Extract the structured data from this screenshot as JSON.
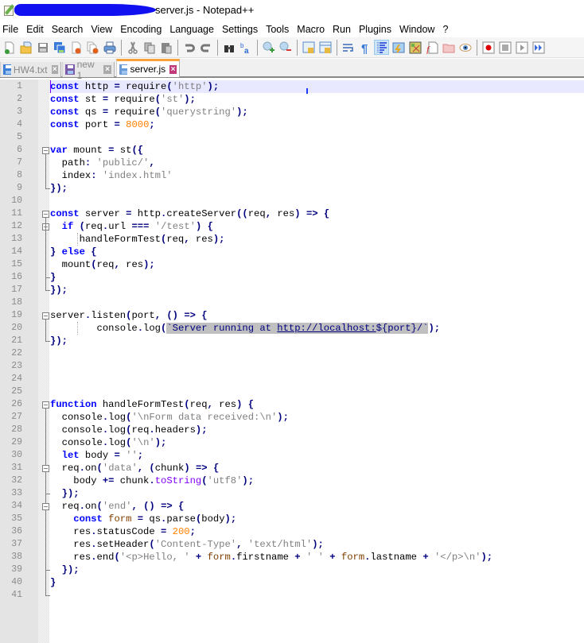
{
  "window": {
    "title": "server.js - Notepad++",
    "title_redacted": true
  },
  "menu": [
    "File",
    "Edit",
    "Search",
    "View",
    "Encoding",
    "Language",
    "Settings",
    "Tools",
    "Macro",
    "Run",
    "Plugins",
    "Window",
    "?"
  ],
  "toolbar": {
    "buttons": [
      {
        "name": "new-file-icon"
      },
      {
        "name": "open-file-icon"
      },
      {
        "name": "save-icon"
      },
      {
        "name": "save-all-icon"
      },
      {
        "name": "close-icon"
      },
      {
        "name": "close-all-icon"
      },
      {
        "name": "print-icon"
      },
      {
        "name": "cut-icon"
      },
      {
        "name": "copy-icon"
      },
      {
        "name": "paste-icon"
      },
      {
        "name": "undo-icon"
      },
      {
        "name": "redo-icon"
      },
      {
        "name": "find-icon"
      },
      {
        "name": "replace-icon"
      },
      {
        "name": "zoom-in-icon"
      },
      {
        "name": "zoom-out-icon"
      },
      {
        "name": "sync-vertical-icon"
      },
      {
        "name": "sync-horizontal-icon"
      },
      {
        "name": "word-wrap-icon"
      },
      {
        "name": "show-all-chars-icon"
      },
      {
        "name": "indent-guide-icon",
        "active": true
      },
      {
        "name": "udl-icon"
      },
      {
        "name": "doc-map-icon"
      },
      {
        "name": "function-list-icon"
      },
      {
        "name": "folder-workspace-icon"
      },
      {
        "name": "monitoring-icon"
      },
      {
        "name": "record-macro-icon"
      },
      {
        "name": "stop-record-icon"
      },
      {
        "name": "playback-icon"
      },
      {
        "name": "run-multiple-icon"
      }
    ]
  },
  "tabs": [
    {
      "label": "HW4.txt",
      "active": false
    },
    {
      "label": "new 1",
      "active": false
    },
    {
      "label": "server.js",
      "active": true
    }
  ],
  "editor": {
    "current_line": 1,
    "lines": [
      {
        "n": "1",
        "t": [
          [
            "kw",
            "const"
          ],
          [
            "id",
            " http "
          ],
          [
            "op",
            "="
          ],
          [
            "id",
            " require"
          ],
          [
            "op",
            "("
          ],
          [
            "str",
            "'http'"
          ],
          [
            "op",
            ");"
          ]
        ]
      },
      {
        "n": "2",
        "t": [
          [
            "kw",
            "const"
          ],
          [
            "id",
            " st "
          ],
          [
            "op",
            "="
          ],
          [
            "id",
            " require"
          ],
          [
            "op",
            "("
          ],
          [
            "str",
            "'st'"
          ],
          [
            "op",
            ");"
          ]
        ]
      },
      {
        "n": "3",
        "t": [
          [
            "kw",
            "const"
          ],
          [
            "id",
            " qs "
          ],
          [
            "op",
            "="
          ],
          [
            "id",
            " require"
          ],
          [
            "op",
            "("
          ],
          [
            "str",
            "'querystring'"
          ],
          [
            "op",
            ");"
          ]
        ]
      },
      {
        "n": "4",
        "t": [
          [
            "kw",
            "const"
          ],
          [
            "id",
            " port "
          ],
          [
            "op",
            "="
          ],
          [
            "id",
            " "
          ],
          [
            "num",
            "8000"
          ],
          [
            "op",
            ";"
          ]
        ]
      },
      {
        "n": "5",
        "t": []
      },
      {
        "n": "6",
        "t": [
          [
            "kw",
            "var"
          ],
          [
            "id",
            " mount "
          ],
          [
            "op",
            "="
          ],
          [
            "id",
            " st"
          ],
          [
            "op",
            "({"
          ]
        ]
      },
      {
        "n": "7",
        "t": [
          [
            "id",
            "  path"
          ],
          [
            "op",
            ":"
          ],
          [
            "id",
            " "
          ],
          [
            "str",
            "'public/'"
          ],
          [
            "op",
            ","
          ]
        ]
      },
      {
        "n": "8",
        "t": [
          [
            "id",
            "  index"
          ],
          [
            "op",
            ":"
          ],
          [
            "id",
            " "
          ],
          [
            "str",
            "'index.html'"
          ]
        ]
      },
      {
        "n": "9",
        "t": [
          [
            "op",
            "});"
          ]
        ]
      },
      {
        "n": "10",
        "t": []
      },
      {
        "n": "11",
        "t": [
          [
            "kw",
            "const"
          ],
          [
            "id",
            " server "
          ],
          [
            "op",
            "="
          ],
          [
            "id",
            " http"
          ],
          [
            "op",
            "."
          ],
          [
            "id",
            "createServer"
          ],
          [
            "op",
            "(("
          ],
          [
            "id",
            "req"
          ],
          [
            "op",
            ","
          ],
          [
            "id",
            " res"
          ],
          [
            "op",
            ")"
          ],
          [
            "id",
            " "
          ],
          [
            "op",
            "=>"
          ],
          [
            "id",
            " "
          ],
          [
            "op",
            "{"
          ]
        ]
      },
      {
        "n": "12",
        "t": [
          [
            "id",
            "  "
          ],
          [
            "kw",
            "if"
          ],
          [
            "id",
            " "
          ],
          [
            "op",
            "("
          ],
          [
            "id",
            "req"
          ],
          [
            "op",
            "."
          ],
          [
            "id",
            "url "
          ],
          [
            "op",
            "==="
          ],
          [
            "id",
            " "
          ],
          [
            "str",
            "'/test'"
          ],
          [
            "op",
            ")"
          ],
          [
            "id",
            " "
          ],
          [
            "op",
            "{"
          ]
        ]
      },
      {
        "n": "13",
        "t": [
          [
            "id",
            "     handleFormTest"
          ],
          [
            "op",
            "("
          ],
          [
            "id",
            "req"
          ],
          [
            "op",
            ","
          ],
          [
            "id",
            " res"
          ],
          [
            "op",
            ");"
          ]
        ]
      },
      {
        "n": "14",
        "t": [
          [
            "op",
            "}"
          ],
          [
            "id",
            " "
          ],
          [
            "kw",
            "else"
          ],
          [
            "id",
            " "
          ],
          [
            "op",
            "{"
          ]
        ]
      },
      {
        "n": "15",
        "t": [
          [
            "id",
            "  mount"
          ],
          [
            "op",
            "("
          ],
          [
            "id",
            "req"
          ],
          [
            "op",
            ","
          ],
          [
            "id",
            " res"
          ],
          [
            "op",
            ");"
          ]
        ]
      },
      {
        "n": "16",
        "t": [
          [
            "op",
            "}"
          ]
        ]
      },
      {
        "n": "17",
        "t": [
          [
            "op",
            "});"
          ]
        ]
      },
      {
        "n": "18",
        "t": []
      },
      {
        "n": "19",
        "t": [
          [
            "id",
            "server"
          ],
          [
            "op",
            "."
          ],
          [
            "id",
            "listen"
          ],
          [
            "op",
            "("
          ],
          [
            "id",
            "port"
          ],
          [
            "op",
            ","
          ],
          [
            "id",
            " "
          ],
          [
            "op",
            "()"
          ],
          [
            "id",
            " "
          ],
          [
            "op",
            "=>"
          ],
          [
            "id",
            " "
          ],
          [
            "op",
            "{"
          ]
        ]
      },
      {
        "n": "20",
        "t": [
          [
            "id",
            "        console"
          ],
          [
            "op",
            "."
          ],
          [
            "id",
            "log"
          ],
          [
            "op",
            "("
          ],
          [
            "tpl",
            "`Server running at "
          ],
          [
            "tplurl",
            "http://localhost:"
          ],
          [
            "tpl",
            "${port}/`"
          ],
          [
            "op",
            ");"
          ]
        ]
      },
      {
        "n": "21",
        "t": [
          [
            "op",
            "});"
          ]
        ]
      },
      {
        "n": "22",
        "t": []
      },
      {
        "n": "23",
        "t": []
      },
      {
        "n": "24",
        "t": []
      },
      {
        "n": "25",
        "t": []
      },
      {
        "n": "26",
        "t": [
          [
            "kw",
            "function"
          ],
          [
            "id",
            " handleFormTest"
          ],
          [
            "op",
            "("
          ],
          [
            "id",
            "req"
          ],
          [
            "op",
            ","
          ],
          [
            "id",
            " res"
          ],
          [
            "op",
            ")"
          ],
          [
            "id",
            " "
          ],
          [
            "op",
            "{"
          ]
        ]
      },
      {
        "n": "27",
        "t": [
          [
            "id",
            "  console"
          ],
          [
            "op",
            "."
          ],
          [
            "id",
            "log"
          ],
          [
            "op",
            "("
          ],
          [
            "str",
            "'\\nForm data received:\\n'"
          ],
          [
            "op",
            ");"
          ]
        ]
      },
      {
        "n": "28",
        "t": [
          [
            "id",
            "  console"
          ],
          [
            "op",
            "."
          ],
          [
            "id",
            "log"
          ],
          [
            "op",
            "("
          ],
          [
            "id",
            "req"
          ],
          [
            "op",
            "."
          ],
          [
            "id",
            "headers"
          ],
          [
            "op",
            ");"
          ]
        ]
      },
      {
        "n": "29",
        "t": [
          [
            "id",
            "  console"
          ],
          [
            "op",
            "."
          ],
          [
            "id",
            "log"
          ],
          [
            "op",
            "("
          ],
          [
            "str",
            "'\\n'"
          ],
          [
            "op",
            ");"
          ]
        ]
      },
      {
        "n": "30",
        "t": [
          [
            "id",
            "  "
          ],
          [
            "kw",
            "let"
          ],
          [
            "id",
            " body "
          ],
          [
            "op",
            "="
          ],
          [
            "id",
            " "
          ],
          [
            "str",
            "''"
          ],
          [
            "op",
            ";"
          ]
        ]
      },
      {
        "n": "31",
        "t": [
          [
            "id",
            "  req"
          ],
          [
            "op",
            "."
          ],
          [
            "id",
            "on"
          ],
          [
            "op",
            "("
          ],
          [
            "str",
            "'data'"
          ],
          [
            "op",
            ","
          ],
          [
            "id",
            " "
          ],
          [
            "op",
            "("
          ],
          [
            "id",
            "chunk"
          ],
          [
            "op",
            ")"
          ],
          [
            "id",
            " "
          ],
          [
            "op",
            "=>"
          ],
          [
            "id",
            " "
          ],
          [
            "op",
            "{"
          ]
        ]
      },
      {
        "n": "32",
        "t": [
          [
            "id",
            "    body "
          ],
          [
            "op",
            "+="
          ],
          [
            "id",
            " chunk"
          ],
          [
            "op",
            "."
          ],
          [
            "meth",
            "toString"
          ],
          [
            "op",
            "("
          ],
          [
            "str",
            "'utf8'"
          ],
          [
            "op",
            ");"
          ]
        ]
      },
      {
        "n": "33",
        "t": [
          [
            "id",
            "  "
          ],
          [
            "op",
            "});"
          ]
        ]
      },
      {
        "n": "34",
        "t": [
          [
            "id",
            "  req"
          ],
          [
            "op",
            "."
          ],
          [
            "id",
            "on"
          ],
          [
            "op",
            "("
          ],
          [
            "str",
            "'end'"
          ],
          [
            "op",
            ","
          ],
          [
            "id",
            " "
          ],
          [
            "op",
            "()"
          ],
          [
            "id",
            " "
          ],
          [
            "op",
            "=>"
          ],
          [
            "id",
            " "
          ],
          [
            "op",
            "{"
          ]
        ]
      },
      {
        "n": "35",
        "t": [
          [
            "id",
            "    "
          ],
          [
            "kw",
            "const"
          ],
          [
            "id",
            " "
          ],
          [
            "obj",
            "form"
          ],
          [
            "id",
            " "
          ],
          [
            "op",
            "="
          ],
          [
            "id",
            " qs"
          ],
          [
            "op",
            "."
          ],
          [
            "id",
            "parse"
          ],
          [
            "op",
            "("
          ],
          [
            "id",
            "body"
          ],
          [
            "op",
            ");"
          ]
        ]
      },
      {
        "n": "36",
        "t": [
          [
            "id",
            "    res"
          ],
          [
            "op",
            "."
          ],
          [
            "id",
            "statusCode "
          ],
          [
            "op",
            "="
          ],
          [
            "id",
            " "
          ],
          [
            "num",
            "200"
          ],
          [
            "op",
            ";"
          ]
        ]
      },
      {
        "n": "37",
        "t": [
          [
            "id",
            "    res"
          ],
          [
            "op",
            "."
          ],
          [
            "id",
            "setHeader"
          ],
          [
            "op",
            "("
          ],
          [
            "str",
            "'Content-Type'"
          ],
          [
            "op",
            ","
          ],
          [
            "id",
            " "
          ],
          [
            "str",
            "'text/html'"
          ],
          [
            "op",
            ");"
          ]
        ]
      },
      {
        "n": "38",
        "t": [
          [
            "id",
            "    res"
          ],
          [
            "op",
            "."
          ],
          [
            "id",
            "end"
          ],
          [
            "op",
            "("
          ],
          [
            "str",
            "'<p>Hello, '"
          ],
          [
            "id",
            " "
          ],
          [
            "op",
            "+"
          ],
          [
            "id",
            " "
          ],
          [
            "obj",
            "form"
          ],
          [
            "op",
            "."
          ],
          [
            "id",
            "firstname "
          ],
          [
            "op",
            "+"
          ],
          [
            "id",
            " "
          ],
          [
            "str",
            "' '"
          ],
          [
            "id",
            " "
          ],
          [
            "op",
            "+"
          ],
          [
            "id",
            " "
          ],
          [
            "obj",
            "form"
          ],
          [
            "op",
            "."
          ],
          [
            "id",
            "lastname "
          ],
          [
            "op",
            "+"
          ],
          [
            "id",
            " "
          ],
          [
            "str",
            "'</p>\\n'"
          ],
          [
            "op",
            ");"
          ]
        ]
      },
      {
        "n": "39",
        "t": [
          [
            "id",
            "  "
          ],
          [
            "op",
            "});"
          ]
        ]
      },
      {
        "n": "40",
        "t": [
          [
            "op",
            "}"
          ]
        ]
      },
      {
        "n": "41",
        "t": []
      }
    ]
  }
}
